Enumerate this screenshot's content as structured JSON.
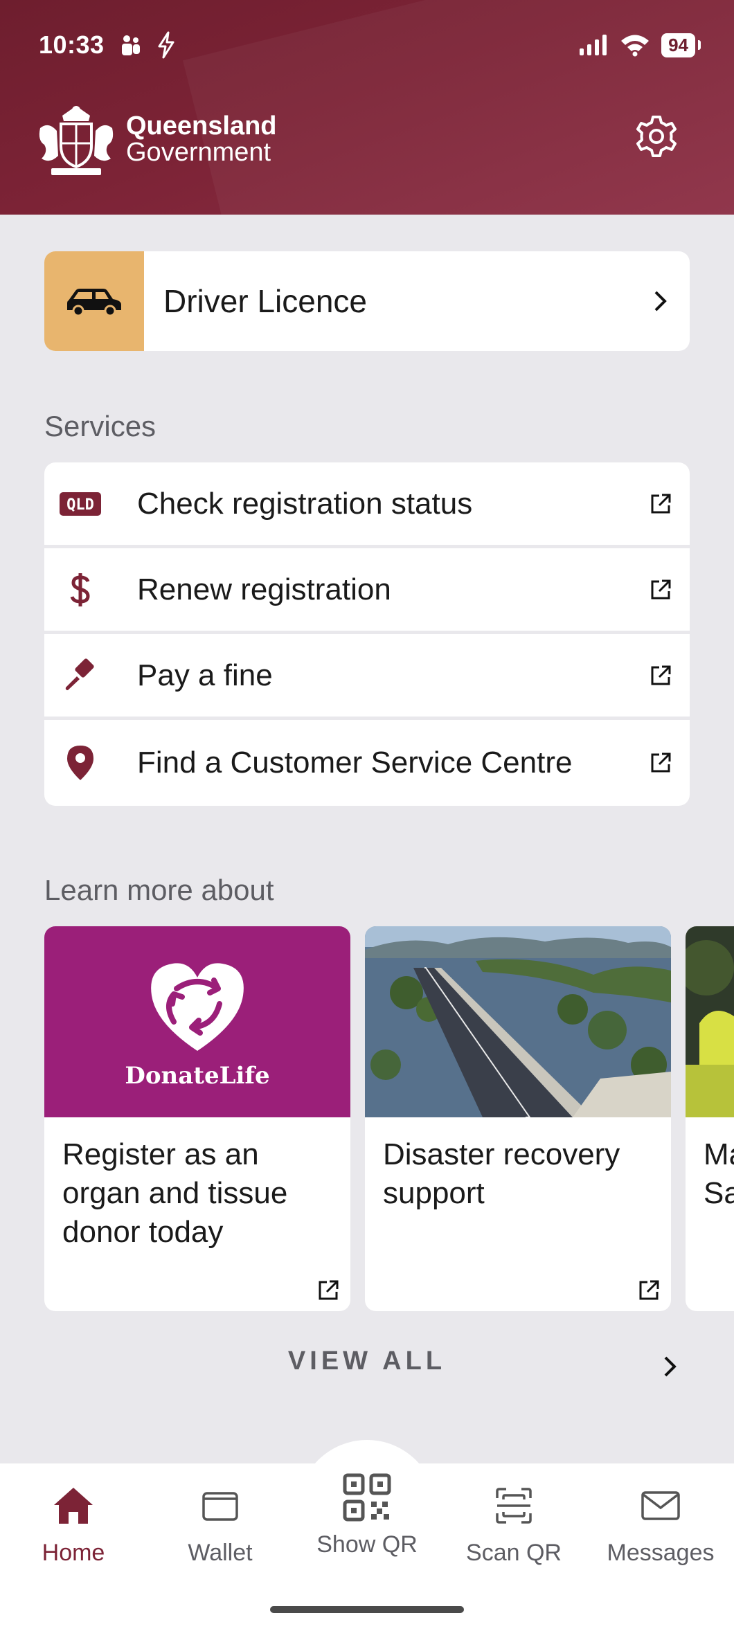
{
  "status_bar": {
    "time": "10:33",
    "battery": "94"
  },
  "header": {
    "logo_line1": "Queensland",
    "logo_line2": "Government"
  },
  "licence": {
    "label": "Driver Licence"
  },
  "services": {
    "title": "Services",
    "items": [
      {
        "label": "Check registration status",
        "icon": "qld-plate-icon"
      },
      {
        "label": "Renew registration",
        "icon": "dollar-icon"
      },
      {
        "label": "Pay a fine",
        "icon": "gavel-icon"
      },
      {
        "label": "Find a Customer Service Centre",
        "icon": "location-pin-icon"
      }
    ]
  },
  "learn": {
    "title": "Learn more about",
    "cards": [
      {
        "label": "Register as an organ and tissue donor today",
        "image_text": "DonateLife"
      },
      {
        "label": "Disaster recovery support"
      },
      {
        "label": "Ma Sa"
      }
    ],
    "view_all": "VIEW ALL"
  },
  "nav": {
    "items": [
      {
        "label": "Home",
        "active": true
      },
      {
        "label": "Wallet"
      },
      {
        "label": "Show QR"
      },
      {
        "label": "Scan QR"
      },
      {
        "label": "Messages"
      }
    ]
  },
  "colors": {
    "brand": "#7c2336",
    "licence_accent": "#e8b56e",
    "donate": "#9b1f79",
    "background": "#e9e8ec"
  }
}
